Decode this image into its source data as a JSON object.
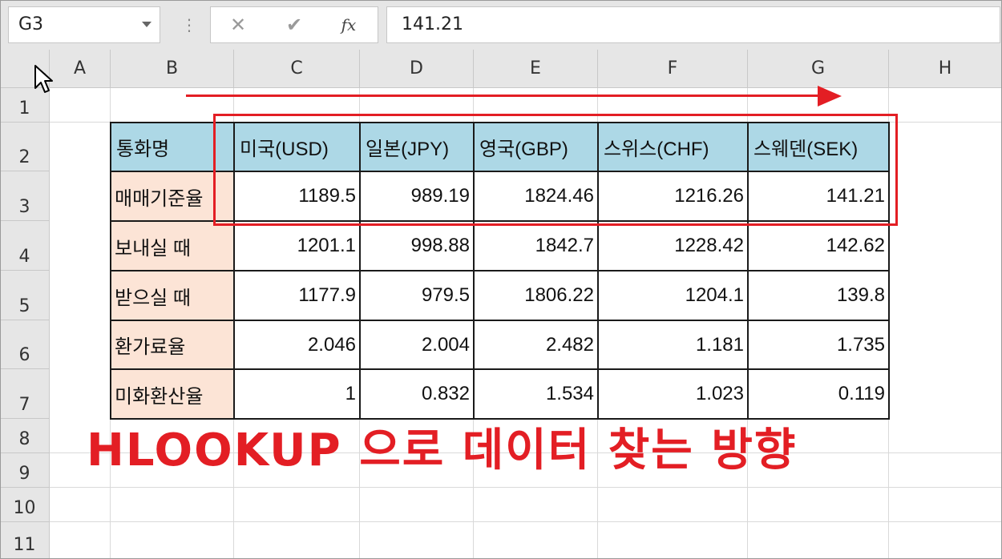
{
  "formula_bar": {
    "name_box": "G3",
    "separator": "⋮",
    "cancel_icon": "✕",
    "enter_icon": "✔",
    "fx_label": "fx",
    "formula_value": "141.21"
  },
  "columns": [
    "A",
    "B",
    "C",
    "D",
    "E",
    "F",
    "G",
    "H"
  ],
  "rows": [
    "1",
    "2",
    "3",
    "4",
    "5",
    "6",
    "7",
    "8",
    "9",
    "10",
    "11"
  ],
  "table": {
    "corner_label": "통화명",
    "headers": [
      "미국(USD)",
      "일본(JPY)",
      "영국(GBP)",
      "스위스(CHF)",
      "스웨덴(SEK)"
    ],
    "body": [
      {
        "label": "매매기준율",
        "values": [
          "1189.5",
          "989.19",
          "1824.46",
          "1216.26",
          "141.21"
        ]
      },
      {
        "label": "보내실 때",
        "values": [
          "1201.1",
          "998.88",
          "1842.7",
          "1228.42",
          "142.62"
        ]
      },
      {
        "label": "받으실 때",
        "values": [
          "1177.9",
          "979.5",
          "1806.22",
          "1204.1",
          "139.8"
        ]
      },
      {
        "label": "환가료율",
        "values": [
          "2.046",
          "2.004",
          "2.482",
          "1.181",
          "1.735"
        ]
      },
      {
        "label": "미화환산율",
        "values": [
          "1",
          "0.832",
          "1.534",
          "1.023",
          "0.119"
        ]
      }
    ]
  },
  "annotation": {
    "caption": "HLOOKUP 으로 데이터 찾는 방향",
    "color": "#e31e24"
  },
  "colors": {
    "header_fill": "#add8e6",
    "label_fill": "#fce4d6",
    "accent_red": "#e31e24"
  },
  "icons": {
    "cursor": "mouse-pointer-icon",
    "dropdown": "chevron-down-icon",
    "arrow": "right-arrow-icon"
  }
}
